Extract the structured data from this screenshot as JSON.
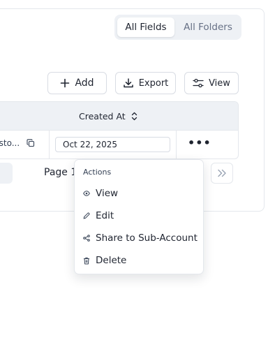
{
  "segmented": {
    "active_label": "All Fields",
    "inactive_label": "All Folders"
  },
  "toolbar": {
    "add_label": "Add",
    "export_label": "Export",
    "view_label": "View"
  },
  "table": {
    "column_created_at": "Created At",
    "row": {
      "truncated_text": "usto...",
      "created_at": "Oct 22, 2025",
      "actions_label": "•••"
    }
  },
  "pagination": {
    "page_label": "Page 1"
  },
  "actions_menu": {
    "title": "Actions",
    "items": [
      {
        "label": "View",
        "icon": "eye-icon"
      },
      {
        "label": "Edit",
        "icon": "pencil-icon"
      },
      {
        "label": "Share to Sub-Account",
        "icon": "share-icon"
      },
      {
        "label": "Delete",
        "icon": "trash-icon"
      }
    ]
  },
  "colors": {
    "header_bg": "#eef1f5",
    "border": "#e4e7ec",
    "text": "#1f2430",
    "muted": "#667085"
  }
}
